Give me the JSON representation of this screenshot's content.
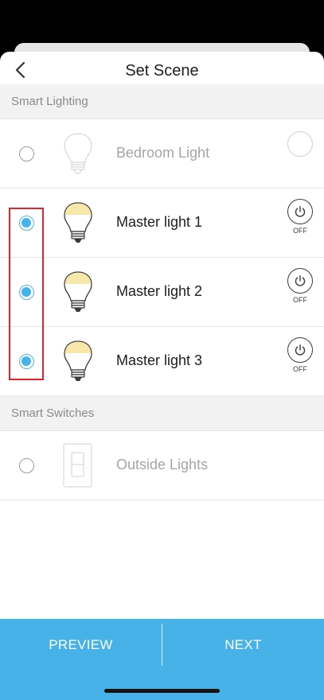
{
  "header": {
    "title": "Set Scene",
    "back_icon": "chevron-left-icon"
  },
  "sections": [
    {
      "title": "Smart Lighting",
      "items": [
        {
          "name": "Bedroom Light",
          "selected": false,
          "disabled": true,
          "icon": "lightbulb-off-icon",
          "power": null
        },
        {
          "name": "Master light 1",
          "selected": true,
          "disabled": false,
          "icon": "lightbulb-on-icon",
          "power": "OFF"
        },
        {
          "name": "Master light 2",
          "selected": true,
          "disabled": false,
          "icon": "lightbulb-on-icon",
          "power": "OFF"
        },
        {
          "name": "Master light 3",
          "selected": true,
          "disabled": false,
          "icon": "lightbulb-on-icon",
          "power": "OFF"
        }
      ]
    },
    {
      "title": "Smart Switches",
      "items": [
        {
          "name": "Outside Lights",
          "selected": false,
          "disabled": true,
          "icon": "light-switch-icon",
          "power": null
        }
      ]
    }
  ],
  "footer": {
    "preview_label": "PREVIEW",
    "next_label": "NEXT"
  },
  "colors": {
    "accent": "#46b2e8",
    "highlight": "#e3232a",
    "bulb_on": "#f7e7a8"
  }
}
